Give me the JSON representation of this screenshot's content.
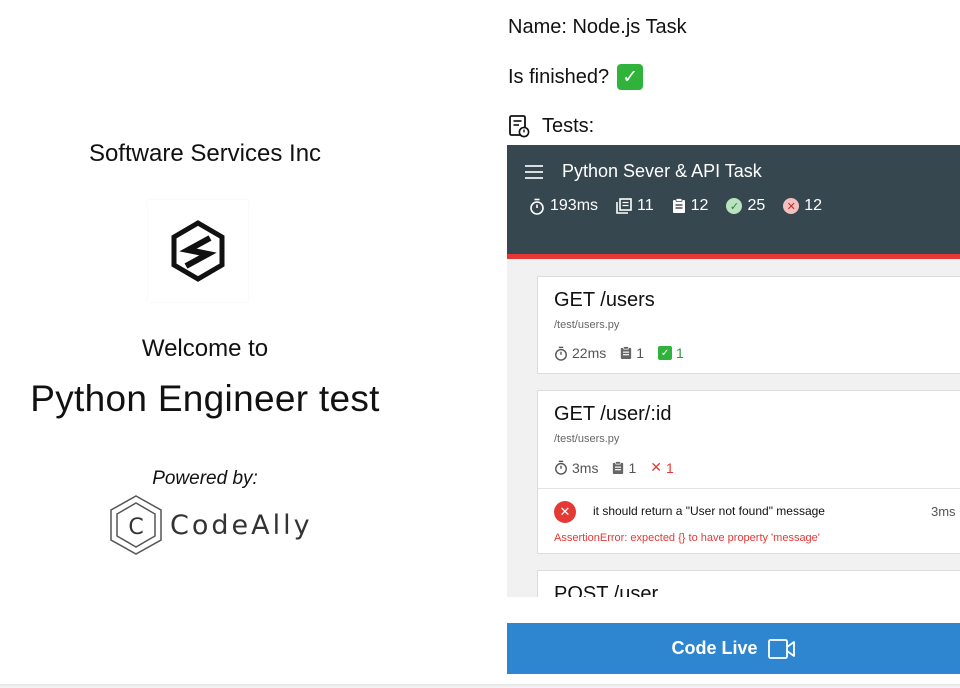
{
  "left": {
    "company": "Software Services Inc",
    "welcome": "Welcome to",
    "test_title": "Python Engineer test",
    "powered_by": "Powered by:",
    "codeally": "CodeAlly",
    "codeally_mark": "C"
  },
  "info": {
    "name": "Name: Node.js Task",
    "finished": "Is finished?",
    "tests": "Tests:"
  },
  "report": {
    "title": "Python Sever & API Task",
    "stats": {
      "duration": "193ms",
      "suites": "11",
      "tests": "12",
      "passes": "25",
      "failures": "12"
    },
    "suites": [
      {
        "title": "GET /users",
        "file": "/test/users.py",
        "duration": "22ms",
        "tests": "1",
        "passes": "1"
      },
      {
        "title": "GET /user/:id",
        "file": "/test/users.py",
        "duration": "3ms",
        "tests": "1",
        "failures": "1",
        "failed_test": {
          "name": "it should return a \"User not found\" message",
          "duration": "3ms",
          "error": "AssertionError: expected {} to have property 'message'"
        }
      },
      {
        "title": "POST /user"
      }
    ]
  },
  "button": {
    "label": "Code Live"
  },
  "colors": {
    "header_bg": "#37474f",
    "header_accent": "#e53935",
    "pass": "#2fb33a",
    "fail": "#e53935",
    "button": "#2f86d0"
  },
  "icons": {
    "check": "✓",
    "cross": "✕"
  }
}
